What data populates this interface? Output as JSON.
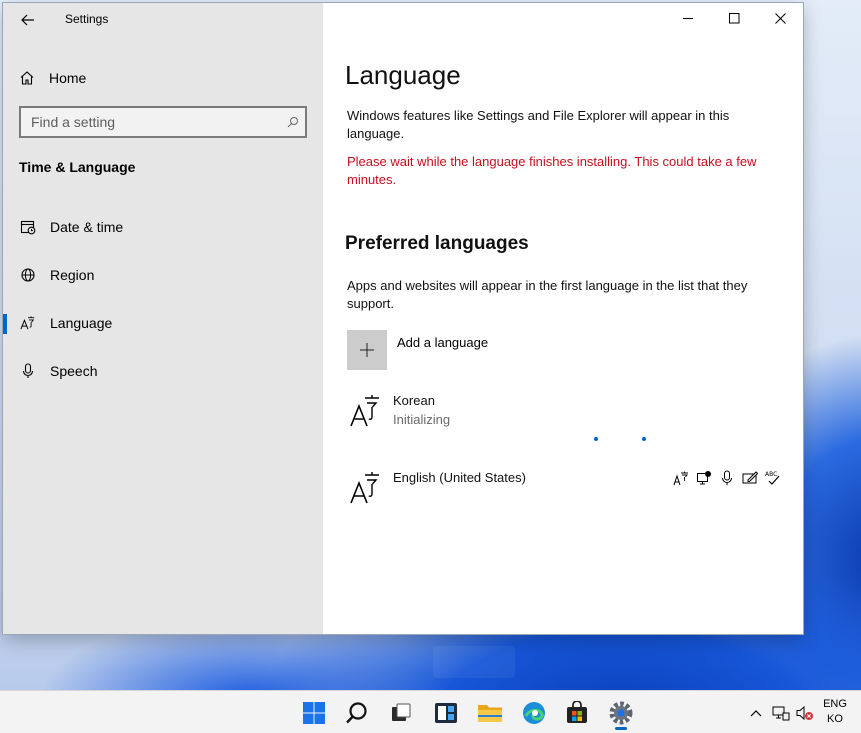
{
  "window": {
    "title": "Settings"
  },
  "sidebar": {
    "home_label": "Home",
    "search_placeholder": "Find a setting",
    "section_title": "Time & Language",
    "items": [
      {
        "label": "Date & time",
        "icon": "calendar-clock-icon"
      },
      {
        "label": "Region",
        "icon": "globe-icon"
      },
      {
        "label": "Language",
        "icon": "language-icon",
        "active": true
      },
      {
        "label": "Speech",
        "icon": "microphone-icon"
      }
    ]
  },
  "content": {
    "title": "Language",
    "description": "Windows features like Settings and File Explorer will appear in this language.",
    "warning": "Please wait while the language finishes installing. This could take a few minutes.",
    "preferred_heading": "Preferred languages",
    "preferred_desc": "Apps and websites will appear in the first language in the list that they support.",
    "add_language_label": "Add a language",
    "languages": [
      {
        "name": "Korean",
        "status": "Initializing"
      },
      {
        "name": "English (United States)",
        "status": ""
      }
    ]
  },
  "taskbar": {
    "apps": [
      "start-icon",
      "search-icon",
      "task-view-icon",
      "widgets-icon",
      "file-explorer-icon",
      "edge-icon",
      "store-icon",
      "settings-icon"
    ],
    "ime_line1": "ENG",
    "ime_line2": "KO"
  },
  "colors": {
    "accent": "#0067c0",
    "warning": "#c50f1f",
    "sidebar_bg": "#e6e6e6"
  }
}
